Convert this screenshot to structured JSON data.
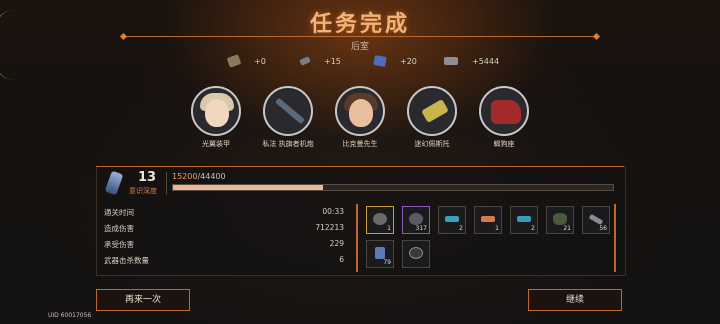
{
  "header": {
    "title": "任务完成",
    "subtitle": "后室"
  },
  "rewards": [
    {
      "icon": "ore-chunk-icon",
      "amount": "+0"
    },
    {
      "icon": "gear-parts-icon",
      "amount": "+15"
    },
    {
      "icon": "blue-crystal-icon",
      "amount": "+20"
    },
    {
      "icon": "cash-bundle-icon",
      "amount": "+5444"
    }
  ],
  "characters": [
    {
      "name": "光翼装甲"
    },
    {
      "name": "私法 执旗者机炮"
    },
    {
      "name": "比克曼先生"
    },
    {
      "name": "迷幻佩斯托"
    },
    {
      "name": "蝎狗座"
    }
  ],
  "level": {
    "value": "13",
    "label": "意识深度",
    "xp_current": "15200",
    "xp_max": "/44400",
    "xp_fraction": 0.342
  },
  "stats": [
    {
      "label": "通关时间",
      "value": "00:33"
    },
    {
      "label": "造成伤害",
      "value": "712213"
    },
    {
      "label": "承受伤害",
      "value": "229"
    },
    {
      "label": "武器击杀数量",
      "value": "6"
    }
  ],
  "items": [
    {
      "qty": "1",
      "icon": "ring-item-icon",
      "color": "#c89a3a"
    },
    {
      "qty": "317",
      "icon": "ring-item-icon",
      "color": "#8a5ab8"
    },
    {
      "qty": "2",
      "icon": "pistol-item-icon",
      "color": "#4a4540"
    },
    {
      "qty": "1",
      "icon": "pistol-item-icon",
      "color": "#4a4540"
    },
    {
      "qty": "2",
      "icon": "pistol-item-icon",
      "color": "#4a4540"
    },
    {
      "qty": "21",
      "icon": "bracelet-item-icon",
      "color": "#4a4540"
    },
    {
      "qty": "56",
      "icon": "blade-item-icon",
      "color": "#4a4540"
    },
    {
      "qty": "79",
      "icon": "canister-item-icon",
      "color": "#4a4540"
    },
    {
      "qty": "",
      "icon": "bracelet-item-icon",
      "color": "#4a4540"
    }
  ],
  "buttons": {
    "retry": "再来一次",
    "continue": "继续"
  },
  "footer": {
    "uid": "UID 60017056"
  }
}
